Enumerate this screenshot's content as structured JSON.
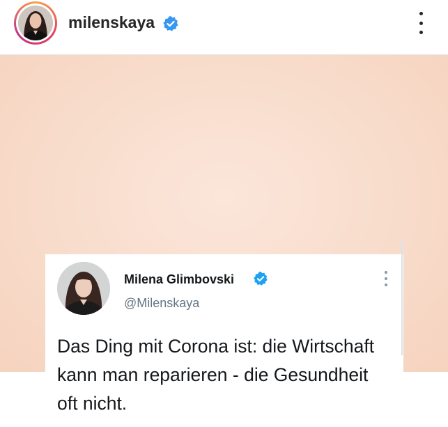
{
  "header": {
    "username": "milenskaya",
    "verified_icon": "verified-badge-icon",
    "more_icon": "more-vertical-icon"
  },
  "tweet": {
    "display_name": "Milena Glimbovski",
    "handle": "@Milenskaya",
    "text": "Das Ding mit Corona ist: die Wirtschaft kann man reparieren - die Gesundheit oft nicht."
  },
  "colors": {
    "verified_blue": "#3897f0",
    "twitter_verified_blue": "#1da1f2",
    "post_background": "#f8dccb"
  }
}
